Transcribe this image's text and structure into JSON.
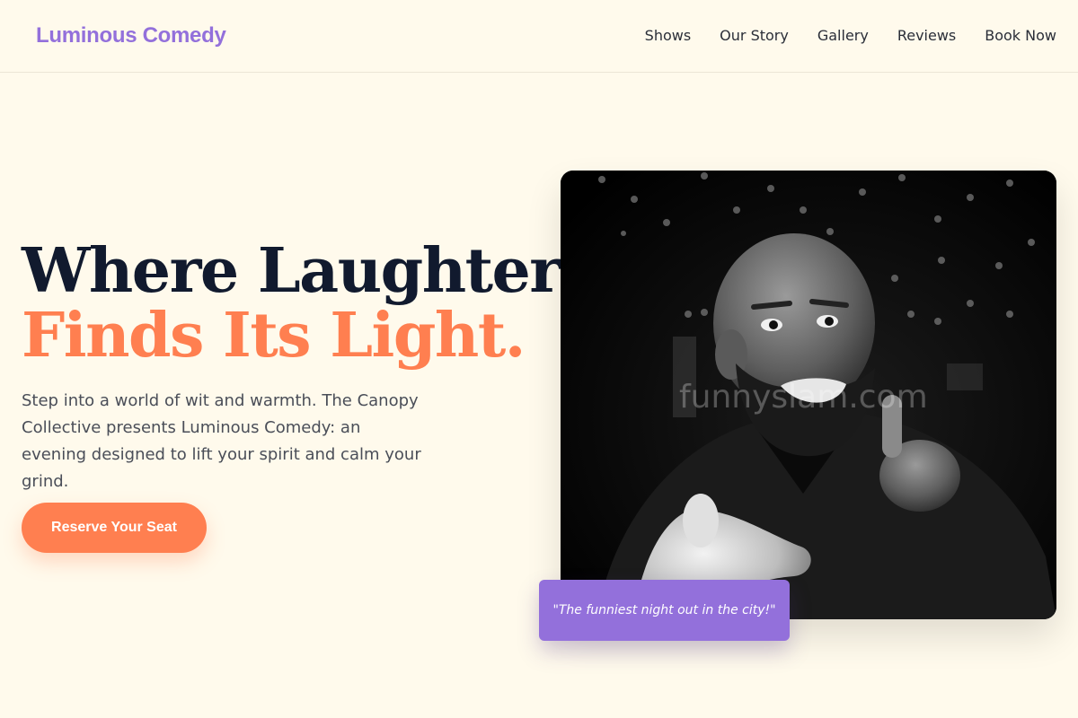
{
  "header": {
    "brand": "Luminous Comedy",
    "nav": [
      "Shows",
      "Our Story",
      "Gallery",
      "Reviews",
      "Book Now"
    ]
  },
  "hero": {
    "headline_line1": "Where Laughter",
    "headline_line2": "Finds Its Light.",
    "description": "Step into a world of wit and warmth. The Canopy Collective presents Luminous Comedy: an evening designed to lift your spirit and calm your grind.",
    "cta_label": "Reserve Your Seat"
  },
  "photo": {
    "watermark": "funnyslam.com"
  },
  "quote": {
    "text": "\"The funniest night out in the city!\""
  },
  "colors": {
    "background": "#fffaec",
    "brand": "#9370db",
    "accent": "#ff7f50",
    "headline": "#111a2e"
  }
}
